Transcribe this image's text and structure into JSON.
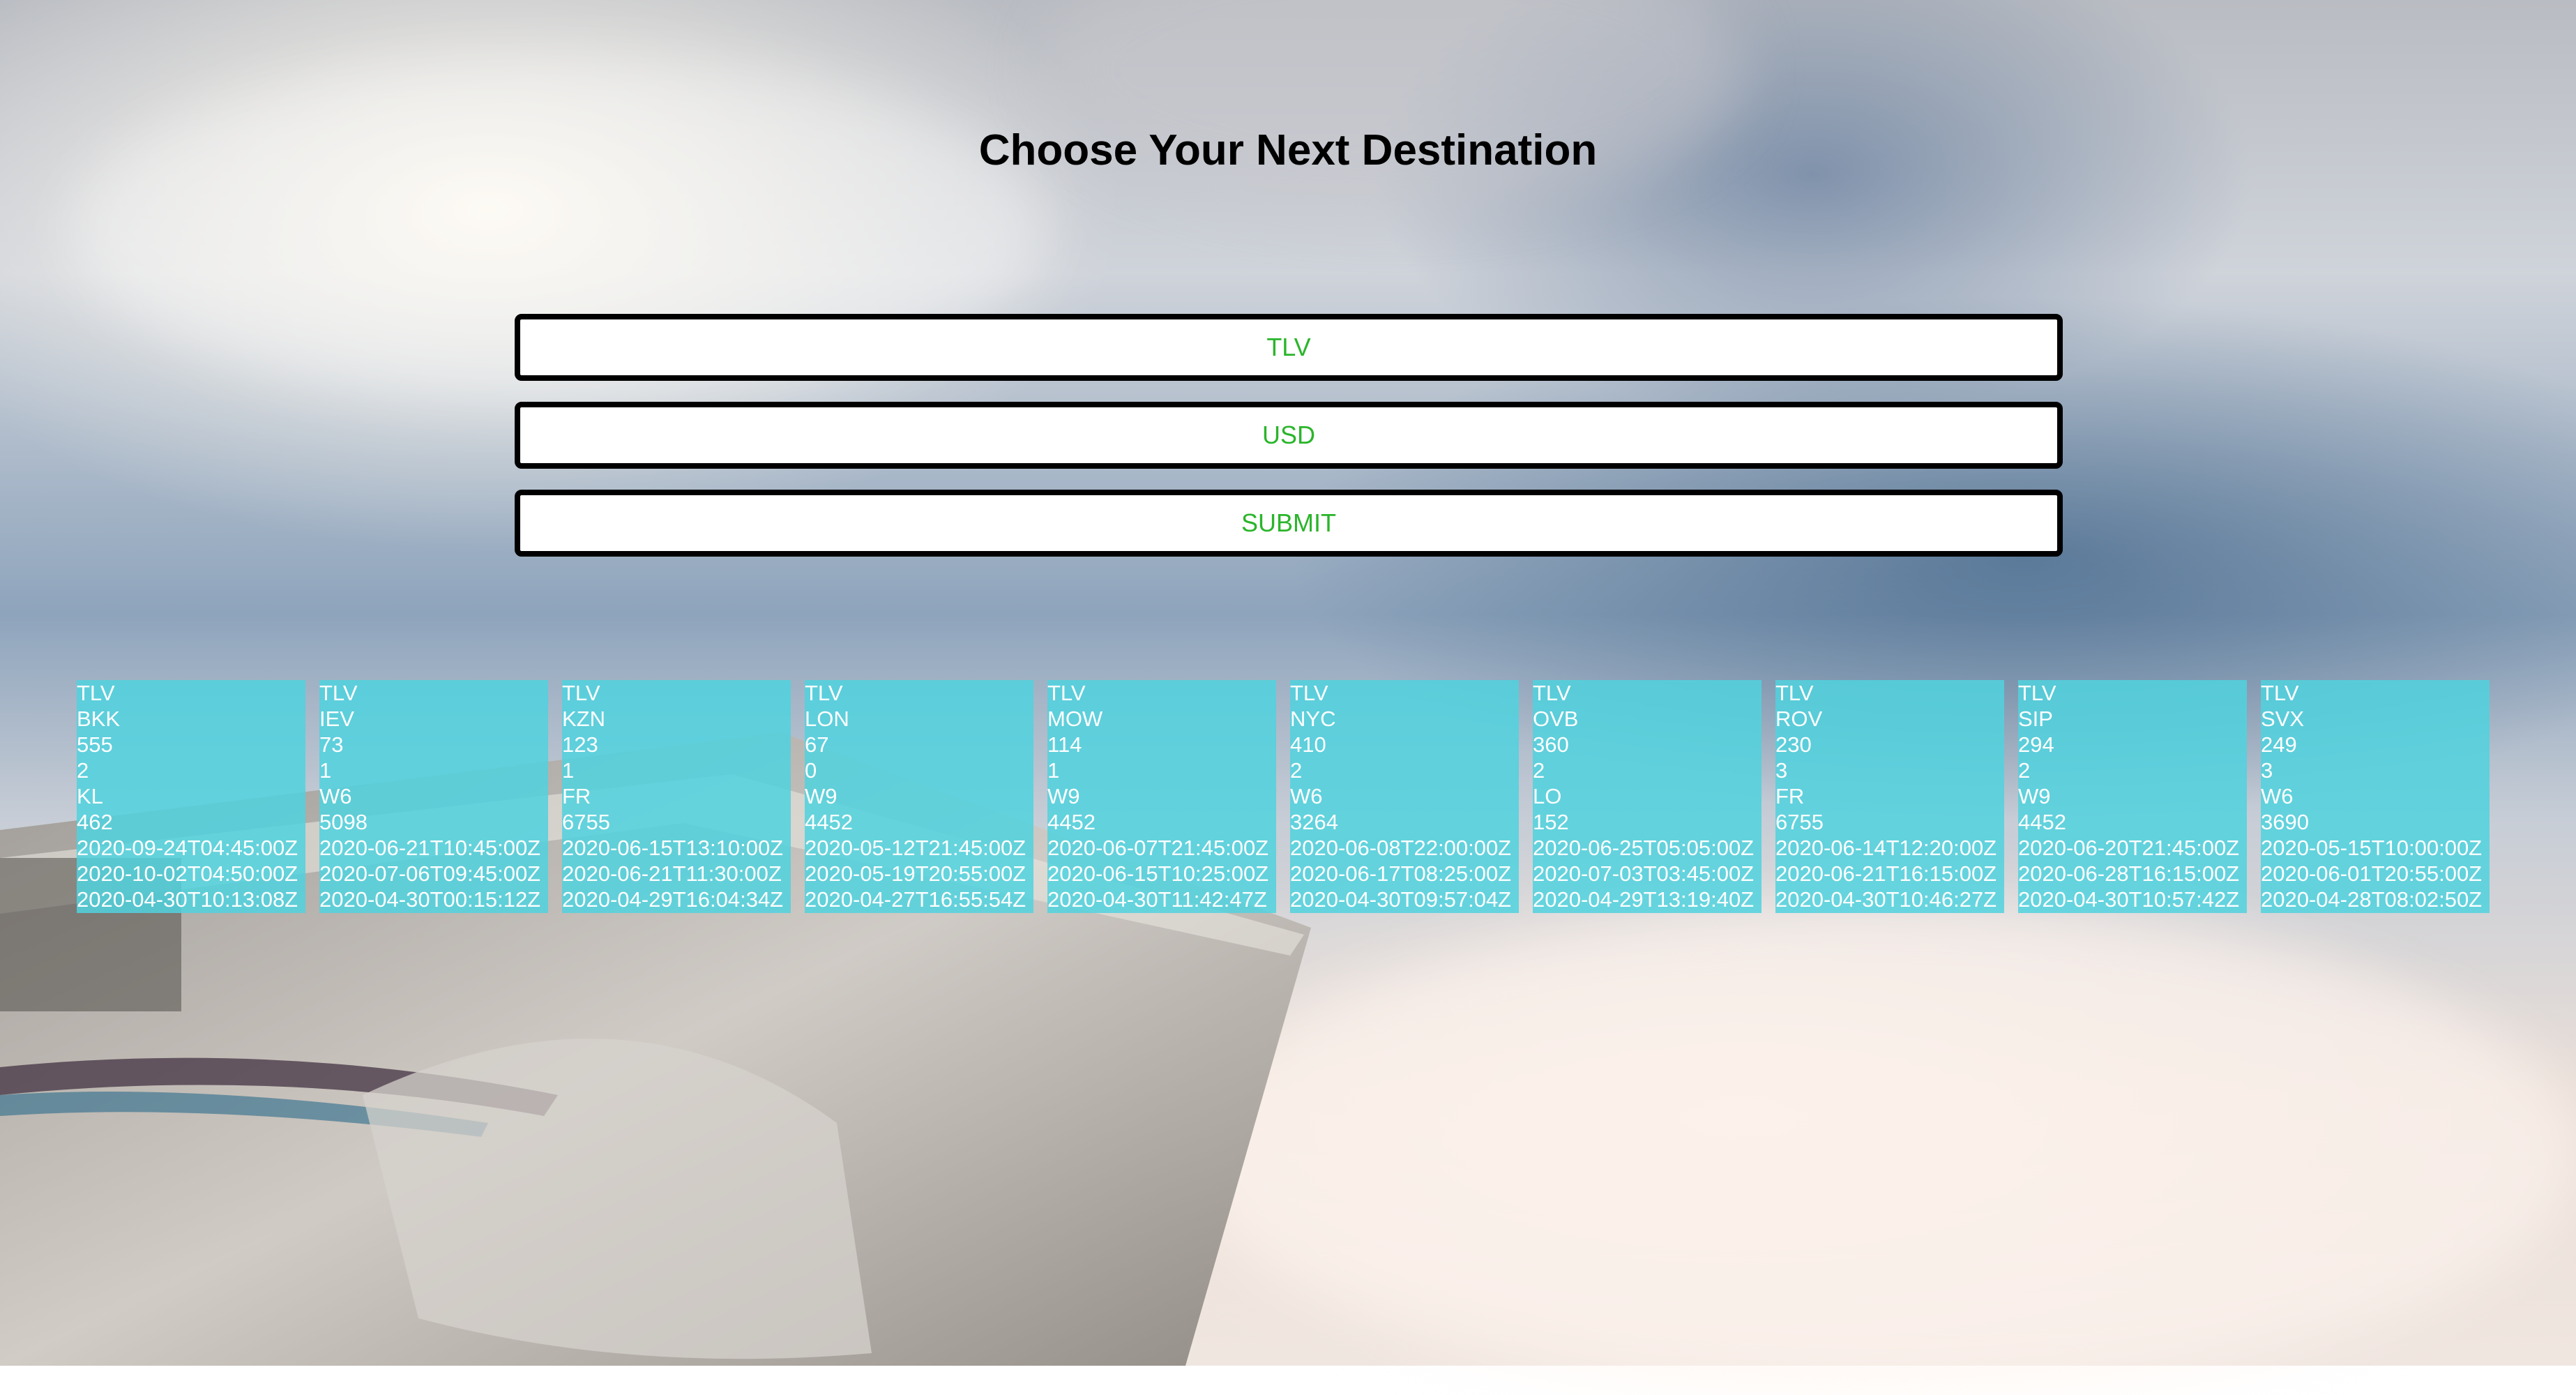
{
  "page": {
    "title": "Choose Your Next Destination"
  },
  "form": {
    "origin_value": "TLV",
    "currency_value": "USD",
    "submit_label": "SUBMIT"
  },
  "colors": {
    "card_background": "#50d2de",
    "field_text": "#2ab52a",
    "field_border": "#000000"
  },
  "flights": [
    {
      "origin": "TLV",
      "destination": "BKK",
      "price": "555",
      "transfers": "2",
      "airline": "KL",
      "flight_number": "462",
      "departure_at": "2020-09-24T04:45:00Z",
      "return_at": "2020-10-02T04:50:00Z",
      "expires_at": "2020-04-30T10:13:08Z"
    },
    {
      "origin": "TLV",
      "destination": "IEV",
      "price": "73",
      "transfers": "1",
      "airline": "W6",
      "flight_number": "5098",
      "departure_at": "2020-06-21T10:45:00Z",
      "return_at": "2020-07-06T09:45:00Z",
      "expires_at": "2020-04-30T00:15:12Z"
    },
    {
      "origin": "TLV",
      "destination": "KZN",
      "price": "123",
      "transfers": "1",
      "airline": "FR",
      "flight_number": "6755",
      "departure_at": "2020-06-15T13:10:00Z",
      "return_at": "2020-06-21T11:30:00Z",
      "expires_at": "2020-04-29T16:04:34Z"
    },
    {
      "origin": "TLV",
      "destination": "LON",
      "price": "67",
      "transfers": "0",
      "airline": "W9",
      "flight_number": "4452",
      "departure_at": "2020-05-12T21:45:00Z",
      "return_at": "2020-05-19T20:55:00Z",
      "expires_at": "2020-04-27T16:55:54Z"
    },
    {
      "origin": "TLV",
      "destination": "MOW",
      "price": "114",
      "transfers": "1",
      "airline": "W9",
      "flight_number": "4452",
      "departure_at": "2020-06-07T21:45:00Z",
      "return_at": "2020-06-15T10:25:00Z",
      "expires_at": "2020-04-30T11:42:47Z"
    },
    {
      "origin": "TLV",
      "destination": "NYC",
      "price": "410",
      "transfers": "2",
      "airline": "W6",
      "flight_number": "3264",
      "departure_at": "2020-06-08T22:00:00Z",
      "return_at": "2020-06-17T08:25:00Z",
      "expires_at": "2020-04-30T09:57:04Z"
    },
    {
      "origin": "TLV",
      "destination": "OVB",
      "price": "360",
      "transfers": "2",
      "airline": "LO",
      "flight_number": "152",
      "departure_at": "2020-06-25T05:05:00Z",
      "return_at": "2020-07-03T03:45:00Z",
      "expires_at": "2020-04-29T13:19:40Z"
    },
    {
      "origin": "TLV",
      "destination": "ROV",
      "price": "230",
      "transfers": "3",
      "airline": "FR",
      "flight_number": "6755",
      "departure_at": "2020-06-14T12:20:00Z",
      "return_at": "2020-06-21T16:15:00Z",
      "expires_at": "2020-04-30T10:46:27Z"
    },
    {
      "origin": "TLV",
      "destination": "SIP",
      "price": "294",
      "transfers": "2",
      "airline": "W9",
      "flight_number": "4452",
      "departure_at": "2020-06-20T21:45:00Z",
      "return_at": "2020-06-28T16:15:00Z",
      "expires_at": "2020-04-30T10:57:42Z"
    },
    {
      "origin": "TLV",
      "destination": "SVX",
      "price": "249",
      "transfers": "3",
      "airline": "W6",
      "flight_number": "3690",
      "departure_at": "2020-05-15T10:00:00Z",
      "return_at": "2020-06-01T20:55:00Z",
      "expires_at": "2020-04-28T08:02:50Z"
    }
  ]
}
